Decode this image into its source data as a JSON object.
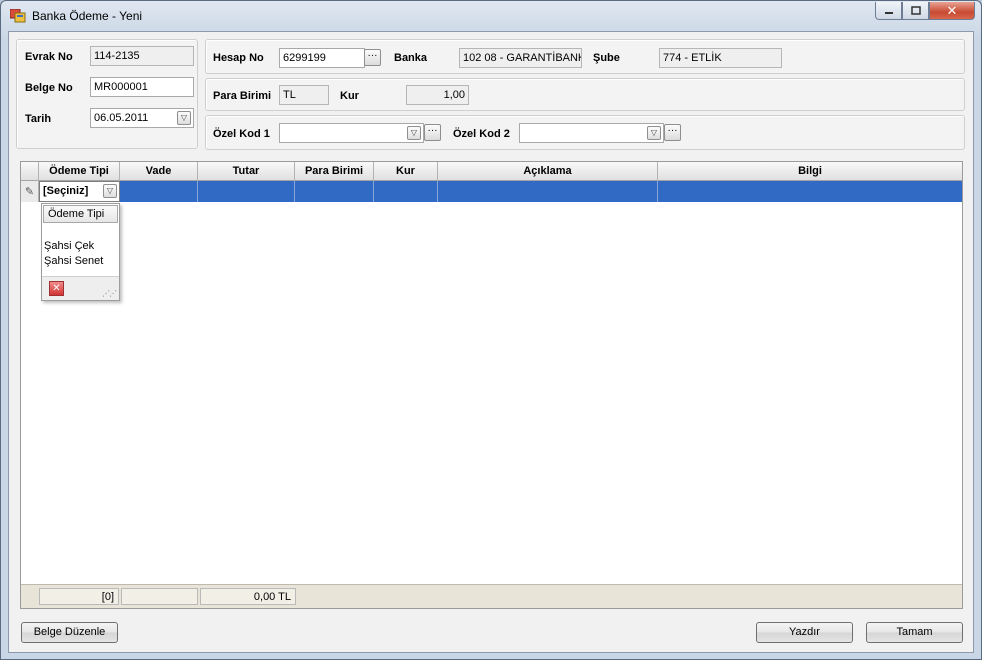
{
  "window": {
    "title": "Banka Ödeme - Yeni"
  },
  "left_panel": {
    "evrak_no_label": "Evrak No",
    "evrak_no_value": "114-2135",
    "belge_no_label": "Belge No",
    "belge_no_value": "MR000001",
    "tarih_label": "Tarih",
    "tarih_value": "06.05.2011"
  },
  "hesap_panel": {
    "hesap_no_label": "Hesap No",
    "hesap_no_value": "6299199",
    "banka_label": "Banka",
    "banka_value": "102 08 - GARANTİBANK",
    "sube_label": "Şube",
    "sube_value": "774 - ETLİK"
  },
  "para_panel": {
    "para_birimi_label": "Para Birimi",
    "para_birimi_value": "TL",
    "kur_label": "Kur",
    "kur_value": "1,00"
  },
  "ozel_panel": {
    "ozel_kod1_label": "Özel Kod 1",
    "ozel_kod1_value": "",
    "ozel_kod2_label": "Özel Kod 2",
    "ozel_kod2_value": ""
  },
  "grid": {
    "columns": [
      "Ödeme Tipi",
      "Vade",
      "Tutar",
      "Para Birimi",
      "Kur",
      "Açıklama",
      "Bilgi"
    ],
    "current_row": {
      "odeme_tipi": "[Seçiniz]"
    },
    "dropdown": {
      "header": "Ödeme Tipi",
      "options": [
        "Şahsi Çek",
        "Şahsi Senet"
      ]
    },
    "footer": {
      "count": "[0]",
      "empty": "",
      "total": "0,00 TL"
    }
  },
  "buttons": {
    "belge_duzenle": "Belge Düzenle",
    "yazdir": "Yazdır",
    "tamam": "Tamam"
  },
  "colors": {
    "selection": "#316ac5",
    "close_button": "#c84a33"
  }
}
